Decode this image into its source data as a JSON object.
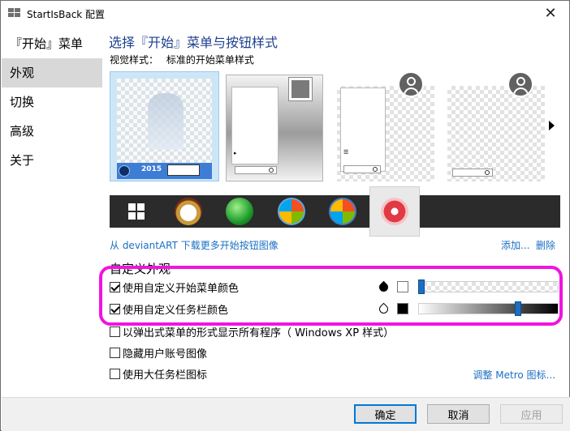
{
  "window": {
    "title": "StartIsBack 配置"
  },
  "sidebar": {
    "heading": "『开始』菜单",
    "items": [
      {
        "label": "外观",
        "active": true
      },
      {
        "label": "切换",
        "active": false
      },
      {
        "label": "高级",
        "active": false
      },
      {
        "label": "关于",
        "active": false
      }
    ]
  },
  "main": {
    "title": "选择『开始』菜单与按钮样式",
    "visual_style_label": "视觉样式：",
    "visual_style_value": "标准的开始菜单样式",
    "thumb_badge_year": "2015"
  },
  "links": {
    "download": "从 deviantART 下载更多开始按钮图像",
    "add": "添加...",
    "delete": "删除"
  },
  "custom_appearance": {
    "title": "自定义外观",
    "start_menu_color": {
      "label": "使用自定义开始菜单颜色",
      "checked": true,
      "swatch_color": "#ffffff",
      "slider": 0.0
    },
    "taskbar_color": {
      "label": "使用自定义任务栏颜色",
      "checked": true,
      "swatch_color": "#000000",
      "slider": 0.7
    }
  },
  "options": [
    {
      "label": "以弹出式菜单的形式显示所有程序（ Windows XP 样式）",
      "checked": false
    },
    {
      "label": "隐藏用户账号图像",
      "checked": false
    },
    {
      "label": "使用大任务栏图标",
      "checked": false
    }
  ],
  "metro_link": "调整 Metro 图标...",
  "buttons": {
    "ok": "确定",
    "cancel": "取消",
    "apply": "应用"
  },
  "colors": {
    "accent": "#0078d7",
    "link": "#1a6fc2",
    "highlight": "#f014e0",
    "title_blue": "#1e3f8f"
  }
}
